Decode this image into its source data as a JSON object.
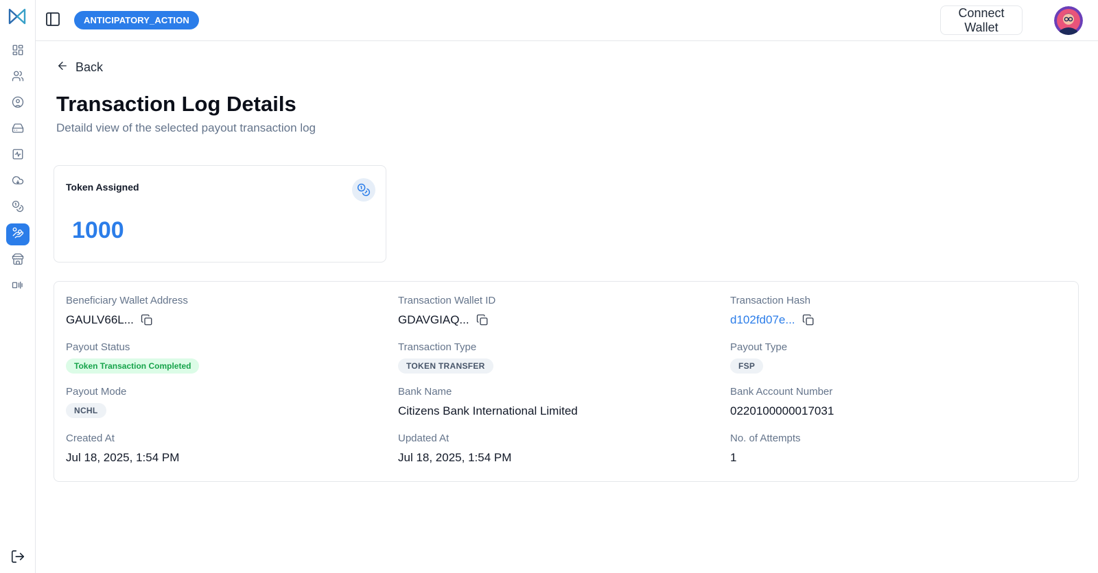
{
  "header": {
    "project_badge": "ANTICIPATORY_ACTION",
    "connect_wallet_label": "Connect Wallet"
  },
  "sidebar": {
    "items": [
      {
        "icon": "dashboard-icon"
      },
      {
        "icon": "users-icon"
      },
      {
        "icon": "user-circle-icon"
      },
      {
        "icon": "hard-drive-icon"
      },
      {
        "icon": "activity-icon"
      },
      {
        "icon": "cloud-icon"
      },
      {
        "icon": "coins-icon"
      },
      {
        "icon": "hand-coins-icon",
        "active": true
      },
      {
        "icon": "store-icon"
      },
      {
        "icon": "signal-icon"
      }
    ],
    "logout_icon": "logout-icon"
  },
  "page": {
    "back_label": "Back",
    "title": "Transaction Log Details",
    "subtitle": "Detaild view of the selected payout transaction log"
  },
  "token_card": {
    "label": "Token Assigned",
    "value": "1000",
    "icon": "coins-icon"
  },
  "details": {
    "beneficiary_wallet_address": {
      "label": "Beneficiary Wallet Address",
      "value": "GAULV66L..."
    },
    "transaction_wallet_id": {
      "label": "Transaction Wallet ID",
      "value": "GDAVGIAQ..."
    },
    "transaction_hash": {
      "label": "Transaction Hash",
      "value": "d102fd07e..."
    },
    "payout_status": {
      "label": "Payout Status",
      "value": "Token Transaction Completed"
    },
    "transaction_type": {
      "label": "Transaction Type",
      "value": "TOKEN TRANSFER"
    },
    "payout_type": {
      "label": "Payout Type",
      "value": "FSP"
    },
    "payout_mode": {
      "label": "Payout Mode",
      "value": "NCHL"
    },
    "bank_name": {
      "label": "Bank Name",
      "value": "Citizens Bank International Limited"
    },
    "bank_account_number": {
      "label": "Bank Account Number",
      "value": "0220100000017031"
    },
    "created_at": {
      "label": "Created At",
      "value": "Jul 18, 2025, 1:54 PM"
    },
    "updated_at": {
      "label": "Updated At",
      "value": "Jul 18, 2025, 1:54 PM"
    },
    "attempts": {
      "label": "No. of Attempts",
      "value": "1"
    }
  },
  "colors": {
    "accent": "#2b7de9",
    "success_bg": "#dcfce7",
    "success_text": "#16a34a"
  }
}
